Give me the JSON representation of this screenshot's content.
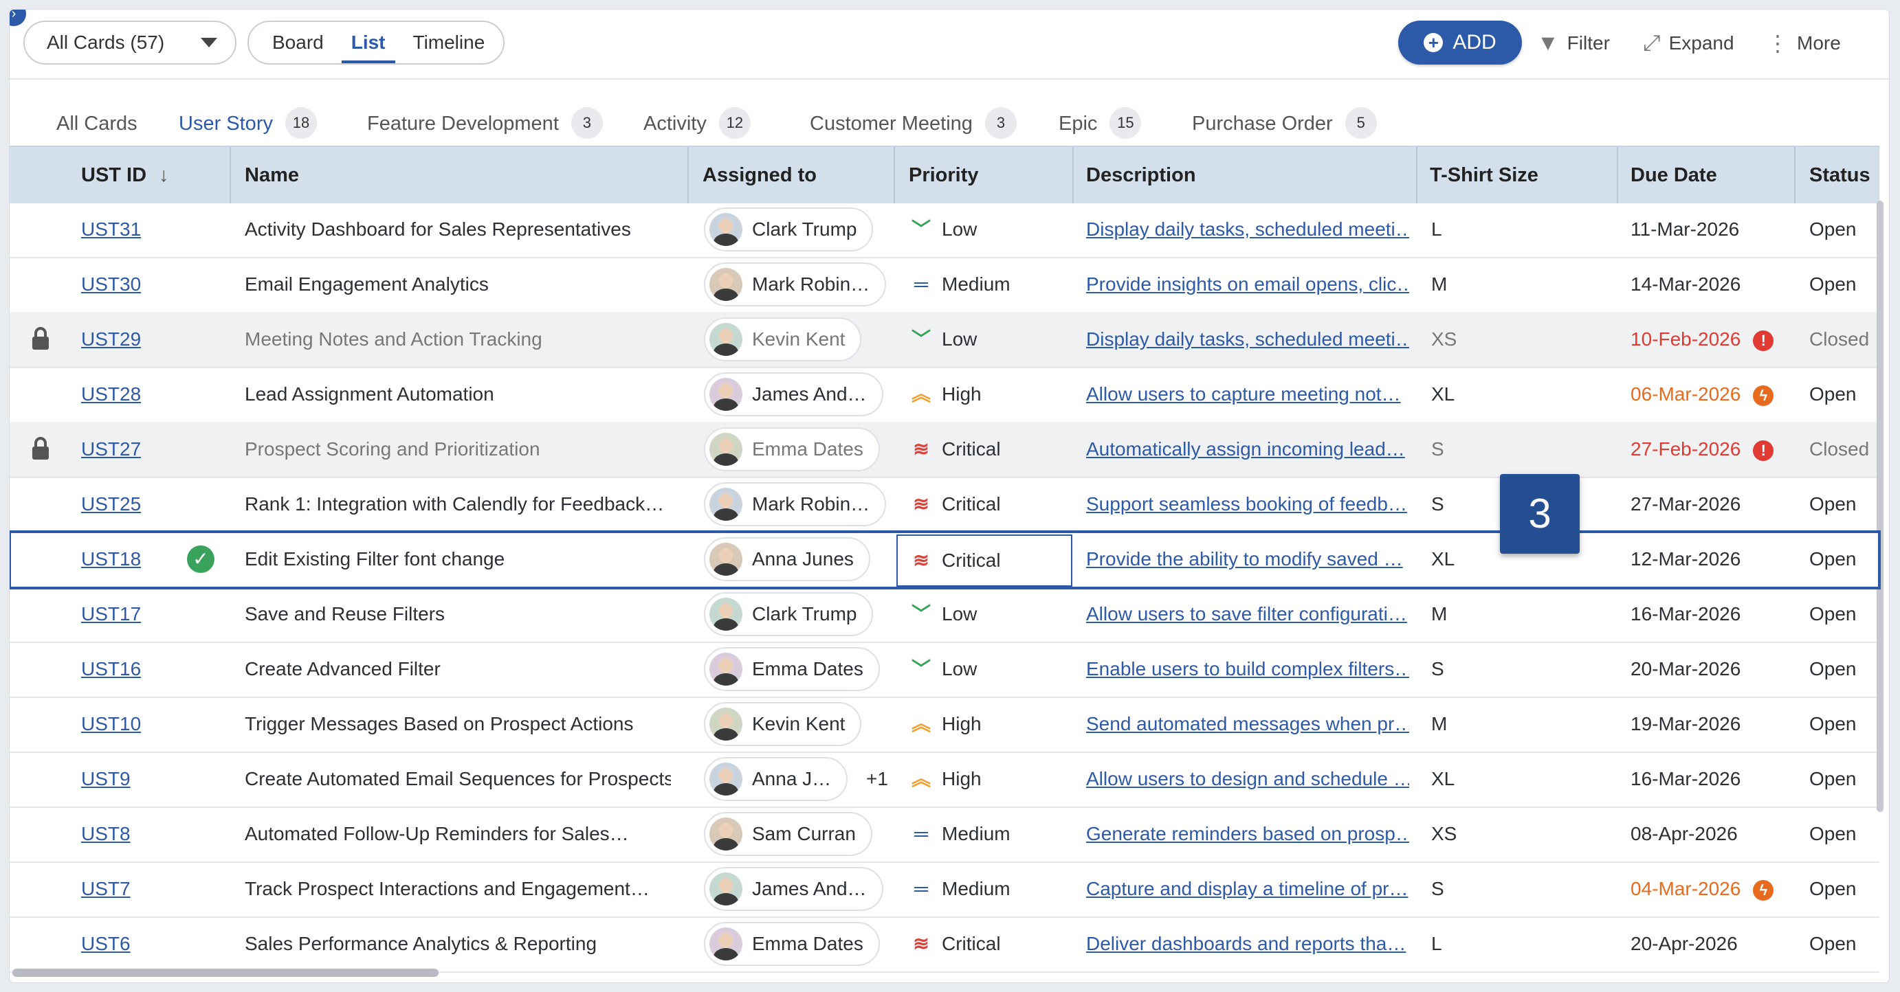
{
  "toolbar": {
    "cards_select": "All Cards (57)",
    "views": [
      "Board",
      "List",
      "Timeline"
    ],
    "active_view": "List",
    "add_label": "ADD",
    "filter_label": "Filter",
    "expand_label": "Expand",
    "more_label": "More"
  },
  "tabs": [
    {
      "label": "All Cards",
      "count": ""
    },
    {
      "label": "User Story",
      "count": "18"
    },
    {
      "label": "Feature Development",
      "count": "3"
    },
    {
      "label": "Activity",
      "count": "12"
    },
    {
      "label": "Customer Meeting",
      "count": "3"
    },
    {
      "label": "Epic",
      "count": "15"
    },
    {
      "label": "Purchase Order",
      "count": "5"
    }
  ],
  "active_tab": "User Story",
  "columns": [
    "UST ID",
    "Name",
    "Assigned to",
    "Priority",
    "Description",
    "T-Shirt Size",
    "Due Date",
    "Status"
  ],
  "sort_indicator": "↓",
  "rows": [
    {
      "id": "UST31",
      "name": "Activity Dashboard for Sales Representatives",
      "assignee": "Clark Trump",
      "priority": "Low",
      "description": "Display daily tasks, scheduled meeti…",
      "size": "L",
      "due": "11-Mar-2026",
      "status": "Open"
    },
    {
      "id": "UST30",
      "name": "Email Engagement Analytics",
      "assignee": "Mark Robin…",
      "priority": "Medium",
      "description": "Provide insights on email opens, clic…",
      "size": "M",
      "due": "14-Mar-2026",
      "status": "Open"
    },
    {
      "id": "UST29",
      "name": "Meeting Notes and Action Tracking",
      "assignee": "Kevin Kent",
      "priority": "Low",
      "description": "Display daily tasks, scheduled meeti…",
      "size": "XS",
      "due": "10-Feb-2026",
      "status": "Closed",
      "locked": true,
      "due_flag": "overdue"
    },
    {
      "id": "UST28",
      "name": "Lead Assignment Automation",
      "assignee": "James And…",
      "priority": "High",
      "description": "Allow users to capture meeting not…",
      "size": "XL",
      "due": "06-Mar-2026",
      "status": "Open",
      "due_flag": "soon"
    },
    {
      "id": "UST27",
      "name": "Prospect Scoring and Prioritization",
      "assignee": "Emma Dates",
      "priority": "Critical",
      "description": "Automatically assign incoming lead…",
      "size": "S",
      "due": "27-Feb-2026",
      "status": "Closed",
      "locked": true,
      "due_flag": "overdue"
    },
    {
      "id": "UST25",
      "name": "Rank 1: Integration with Calendly for Feedback…",
      "assignee": "Mark Robin…",
      "priority": "Critical",
      "description": "Support seamless booking of feedb…",
      "size": "S",
      "due": "27-Mar-2026",
      "status": "Open"
    },
    {
      "id": "UST18",
      "name": "Edit Existing Filter font change",
      "assignee": "Anna Junes",
      "priority": "Critical",
      "description": "Provide the ability to modify saved …",
      "size": "XL",
      "due": "12-Mar-2026",
      "status": "Open",
      "selected": true,
      "done": true
    },
    {
      "id": "UST17",
      "name": "Save and Reuse Filters",
      "assignee": "Clark Trump",
      "priority": "Low",
      "description": "Allow users to save filter configurati…",
      "size": "M",
      "due": "16-Mar-2026",
      "status": "Open"
    },
    {
      "id": "UST16",
      "name": "Create Advanced Filter",
      "assignee": "Emma Dates",
      "priority": "Low",
      "description": "Enable users to build complex filters…",
      "size": "S",
      "due": "20-Mar-2026",
      "status": "Open"
    },
    {
      "id": "UST10",
      "name": "Trigger Messages Based on Prospect Actions",
      "assignee": "Kevin Kent",
      "priority": "High",
      "description": "Send automated messages when pr…",
      "size": "M",
      "due": "19-Mar-2026",
      "status": "Open"
    },
    {
      "id": "UST9",
      "name": "Create Automated Email Sequences for Prospects",
      "assignee": "Anna J…",
      "extra": "+1",
      "priority": "High",
      "description": "Allow users to design and schedule …",
      "size": "XL",
      "due": "16-Mar-2026",
      "status": "Open"
    },
    {
      "id": "UST8",
      "name": "Automated Follow-Up Reminders for Sales…",
      "assignee": "Sam Curran",
      "priority": "Medium",
      "description": "Generate reminders based on prosp…",
      "size": "XS",
      "due": "08-Apr-2026",
      "status": "Open"
    },
    {
      "id": "UST7",
      "name": "Track Prospect Interactions and Engagement…",
      "assignee": "James And…",
      "priority": "Medium",
      "description": "Capture and display a timeline of pr…",
      "size": "S",
      "due": "04-Mar-2026",
      "status": "Open",
      "due_flag": "soon"
    },
    {
      "id": "UST6",
      "name": "Sales Performance Analytics & Reporting",
      "assignee": "Emma Dates",
      "priority": "Critical",
      "description": "Deliver dashboards and reports tha…",
      "size": "L",
      "due": "20-Apr-2026",
      "status": "Open"
    }
  ],
  "priority_colors": {
    "Low": "#3aa35b",
    "Medium": "#2d5aa8",
    "High": "#f0a030",
    "Critical": "#d9433a"
  },
  "due_colors": {
    "overdue": "#e03a32",
    "soon": "#e86a1c"
  },
  "overlay_badge": "3"
}
